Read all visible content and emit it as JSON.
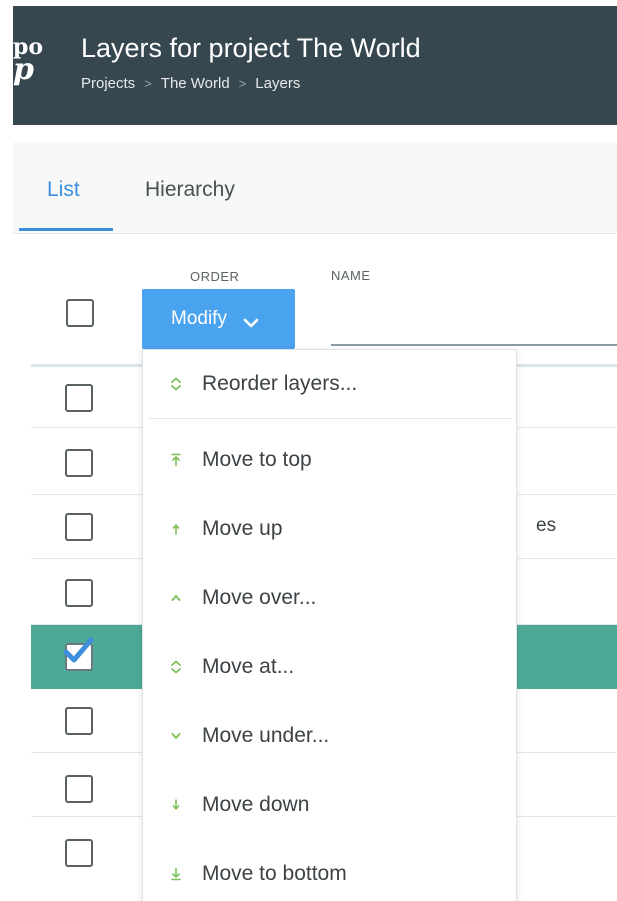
{
  "header": {
    "logo_line1": "po",
    "logo_line2": "p",
    "title": "Layers for project The World",
    "breadcrumb": [
      "Projects",
      "The World",
      "Layers"
    ],
    "breadcrumb_separator": ">"
  },
  "tabs": [
    {
      "label": "List",
      "active": true
    },
    {
      "label": "Hierarchy",
      "active": false
    }
  ],
  "table": {
    "columns": {
      "order": "ORDER",
      "name": "NAME"
    },
    "name_filter_value": "",
    "rows": [
      {
        "checked": false,
        "selected": false,
        "text": ""
      },
      {
        "checked": false,
        "selected": false,
        "text": ""
      },
      {
        "checked": false,
        "selected": false,
        "text": "es"
      },
      {
        "checked": false,
        "selected": false,
        "text": ""
      },
      {
        "checked": true,
        "selected": true,
        "text": ""
      },
      {
        "checked": false,
        "selected": false,
        "text": ""
      },
      {
        "checked": false,
        "selected": false,
        "text": ""
      },
      {
        "checked": false,
        "selected": false,
        "text": ""
      }
    ]
  },
  "modify_button": {
    "label": "Modify",
    "icon": "chevron-down-icon"
  },
  "dropdown": {
    "items": [
      {
        "label": "Reorder layers...",
        "icon": "reorder-icon"
      },
      {
        "label": "Move to top",
        "icon": "move-top-icon"
      },
      {
        "label": "Move up",
        "icon": "arrow-up-icon"
      },
      {
        "label": "Move over...",
        "icon": "chevron-up-icon"
      },
      {
        "label": "Move at...",
        "icon": "reorder-icon"
      },
      {
        "label": "Move under...",
        "icon": "chevron-down-icon"
      },
      {
        "label": "Move down",
        "icon": "arrow-down-icon"
      },
      {
        "label": "Move to bottom",
        "icon": "move-bottom-icon"
      }
    ]
  },
  "colors": {
    "header_bg": "#37474f",
    "accent_blue": "#3d8fdd",
    "button_blue": "#4aa3ef",
    "selected_row": "#4ea896",
    "icon_green": "#7cc05a"
  }
}
